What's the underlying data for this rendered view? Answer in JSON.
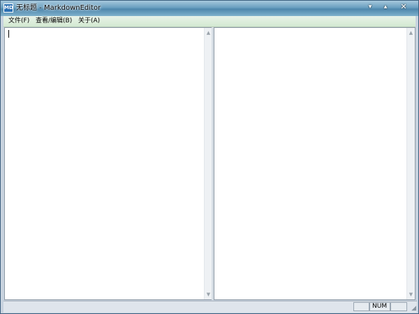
{
  "window": {
    "title": "无标题 - MarkdownEditor",
    "app_icon_text": "MD",
    "controls": {
      "minimize": "▾",
      "maximize": "▴",
      "close": "✕"
    }
  },
  "menu": {
    "items": [
      {
        "label": "文件(F)"
      },
      {
        "label": "查看/编辑(B)"
      },
      {
        "label": "关于(A)"
      }
    ]
  },
  "editor": {
    "content": ""
  },
  "preview": {
    "content": ""
  },
  "scrollbar": {
    "up": "▲",
    "down": "▼"
  },
  "statusbar": {
    "cells": [
      "",
      "NUM",
      ""
    ],
    "grip": "◢"
  },
  "colors": {
    "menubar": "#d3e9d1",
    "pane_bg": "#ffffff",
    "statusbar": "#dfe5ec"
  }
}
